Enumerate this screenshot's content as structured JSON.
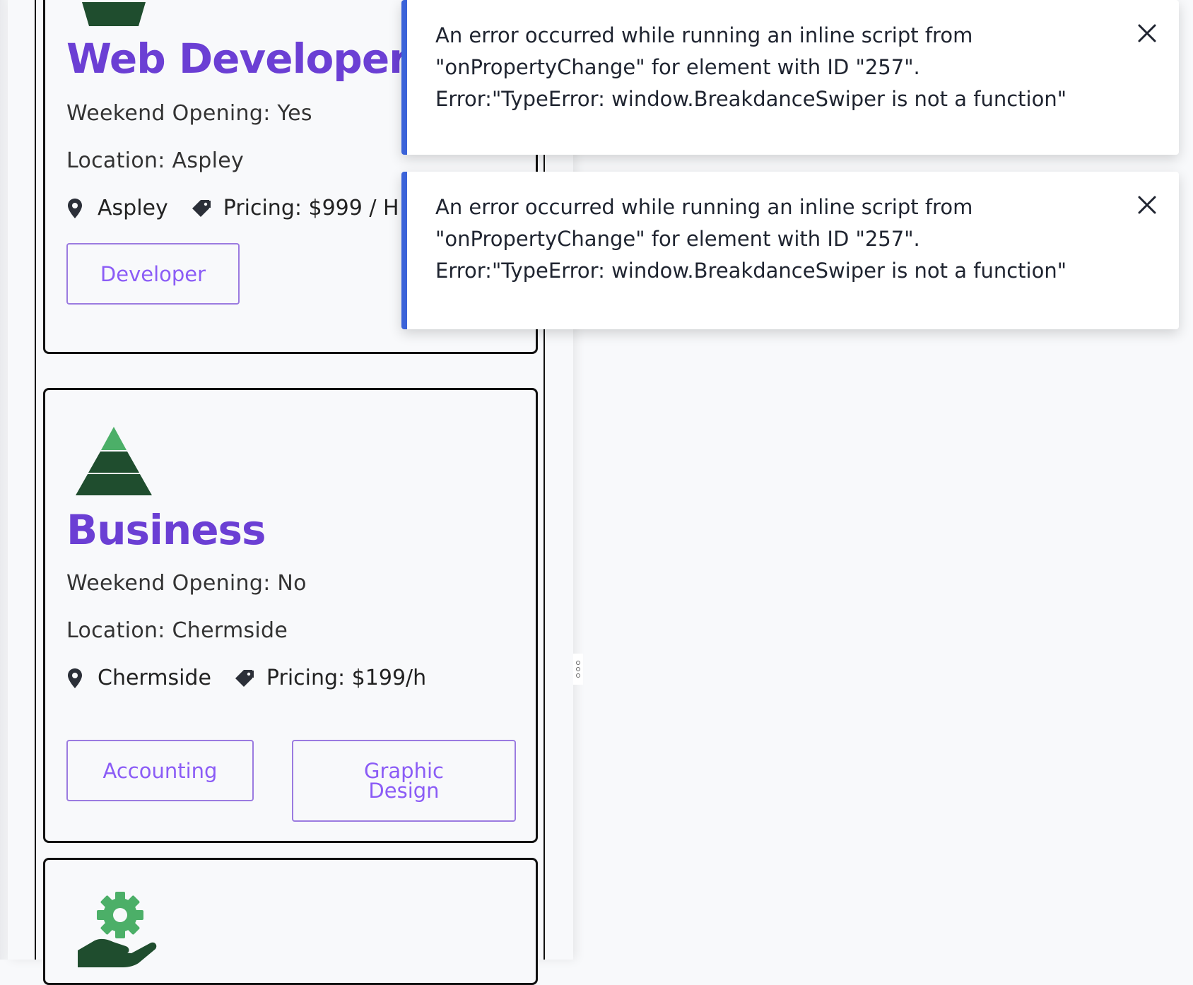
{
  "cards": [
    {
      "title": "Web Developer",
      "weekend": "Weekend Opening: Yes",
      "location": "Location: Aspley",
      "suburb": "Aspley",
      "pricing": "Pricing: $999 / H",
      "tags": [
        "Developer"
      ]
    },
    {
      "title": "Business",
      "weekend": "Weekend Opening: No",
      "location": "Location: Chermside",
      "suburb": "Chermside",
      "pricing": "Pricing: $199/h",
      "tags": [
        "Accounting",
        "Graphic Design"
      ]
    }
  ],
  "toasts": [
    {
      "message": "An error occurred while running an inline script from \"onPropertyChange\" for element with ID \"257\". Error:\"TypeError: window.BreakdanceSwiper is not a function\""
    },
    {
      "message": "An error occurred while running an inline script from \"onPropertyChange\" for element with ID \"257\". Error:\"TypeError: window.BreakdanceSwiper is not a function\""
    }
  ],
  "icons": {
    "location": "map-pin-icon",
    "pricing": "price-tag-icon",
    "close": "close-icon",
    "card1": "stack-icon",
    "card2": "pyramid-icon",
    "card3": "gear-hand-icon"
  },
  "colors": {
    "title": "#6b3fd4",
    "tag_border": "#9b7be0",
    "tag_text": "#8b5cf6",
    "toast_accent": "#3b63d9",
    "icon_dark_green": "#1f4d2e",
    "icon_light_green": "#4caf68"
  }
}
